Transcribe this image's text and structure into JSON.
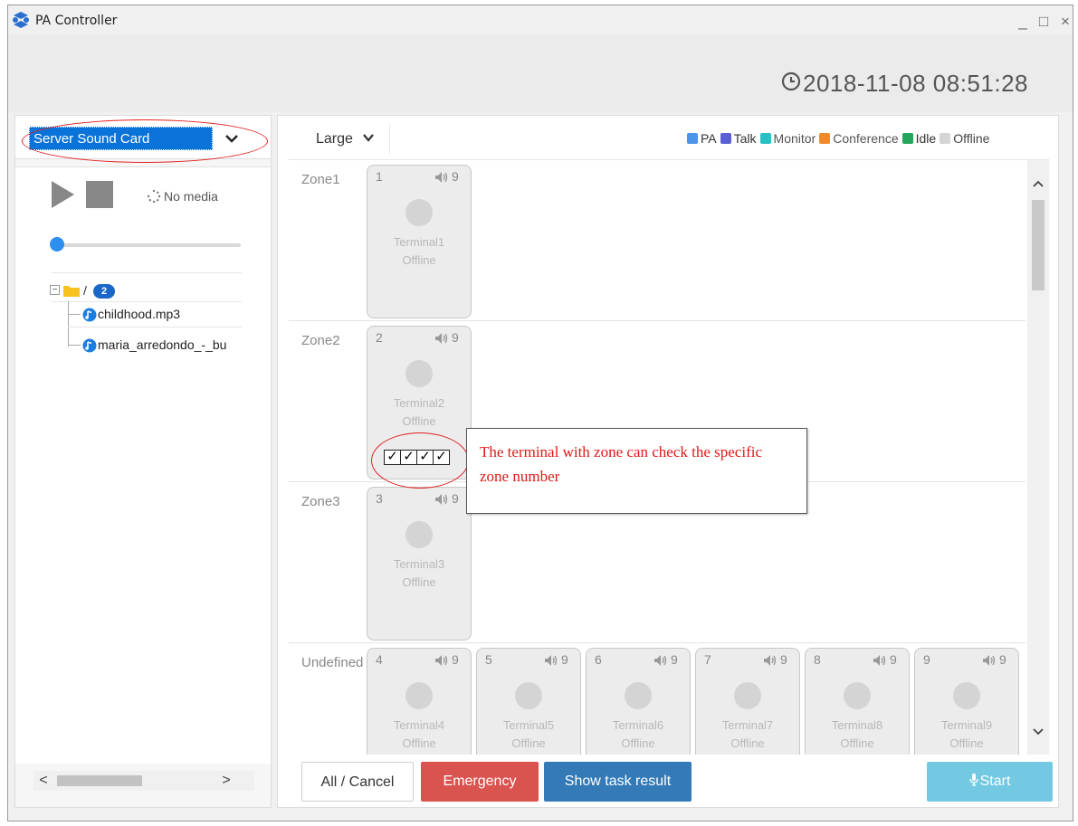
{
  "window": {
    "title": "PA Controller",
    "minimize": "_",
    "maximize": "□",
    "close": "×"
  },
  "header": {
    "datetime": "2018-11-08 08:51:28"
  },
  "left": {
    "source_value": "Server Sound Card",
    "media_status": "No media",
    "seek_progress": 0,
    "tree_root": "/",
    "tree_count": "2",
    "files": [
      "childhood.mp3",
      "maria_arredondo_-_bu"
    ]
  },
  "right": {
    "size_value": "Large",
    "legend": [
      {
        "label": "PA",
        "color": "#4b94e8"
      },
      {
        "label": "Talk",
        "color": "#5b5fd6"
      },
      {
        "label": "Monitor",
        "color": "#29c0c4"
      },
      {
        "label": "Conference",
        "color": "#f08a2a"
      },
      {
        "label": "Idle",
        "color": "#23a55a"
      },
      {
        "label": "Offline",
        "color": "#d5d5d5"
      }
    ],
    "zones": [
      {
        "label": "Zone1"
      },
      {
        "label": "Zone2"
      },
      {
        "label": "Zone3"
      },
      {
        "label": "Undefined"
      }
    ],
    "terminals": [
      {
        "num": "1",
        "vol": "9",
        "name": "Terminal1",
        "status": "Offline"
      },
      {
        "num": "2",
        "vol": "9",
        "name": "Terminal2",
        "status": "Offline",
        "zone_checks": [
          "✓",
          "✓",
          "✓",
          "✓"
        ]
      },
      {
        "num": "3",
        "vol": "9",
        "name": "Terminal3",
        "status": "Offline"
      },
      {
        "num": "4",
        "vol": "9",
        "name": "Terminal4",
        "status": "Offline"
      },
      {
        "num": "5",
        "vol": "9",
        "name": "Terminal5",
        "status": "Offline"
      },
      {
        "num": "6",
        "vol": "9",
        "name": "Terminal6",
        "status": "Offline"
      },
      {
        "num": "7",
        "vol": "9",
        "name": "Terminal7",
        "status": "Offline"
      },
      {
        "num": "8",
        "vol": "9",
        "name": "Terminal8",
        "status": "Offline"
      },
      {
        "num": "9",
        "vol": "9",
        "name": "Terminal9",
        "status": "Offline"
      }
    ]
  },
  "annotation": {
    "callout": "The terminal with zone can check the specific zone number"
  },
  "buttons": {
    "all_cancel": "All / Cancel",
    "emergency": "Emergency",
    "show_task_result": "Show task result",
    "start": "Start"
  },
  "icons": {
    "app": "pa-logo-icon",
    "clock": "clock-icon",
    "play": "play-icon",
    "stop": "stop-icon",
    "spinner": "spinner-icon",
    "folder": "folder-icon",
    "file": "audio-file-icon",
    "speaker": "speaker-icon",
    "mic": "microphone-icon"
  }
}
